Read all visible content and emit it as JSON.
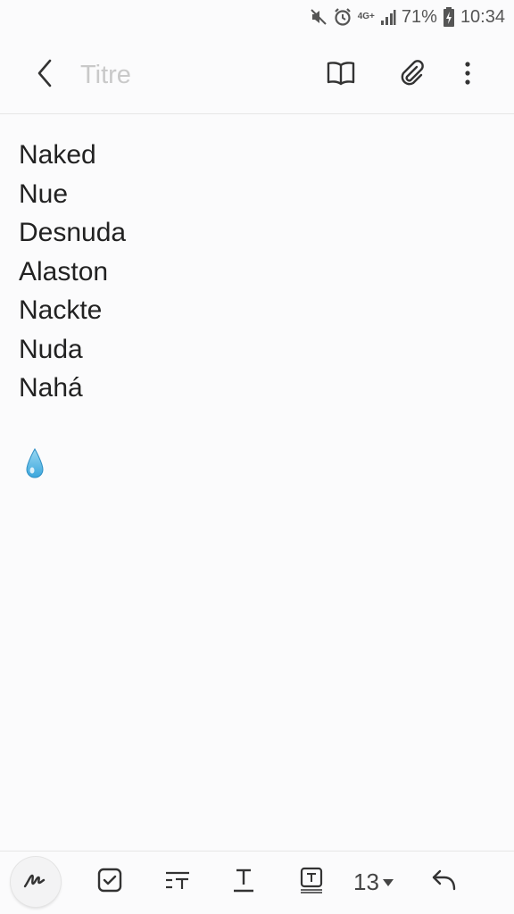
{
  "status_bar": {
    "network": "4G+",
    "battery_percent": "71%",
    "time": "10:34"
  },
  "header": {
    "title_placeholder": "Titre",
    "title_value": "",
    "icons": [
      "back-icon",
      "book-icon",
      "attachment-icon",
      "more-icon"
    ]
  },
  "note": {
    "lines": [
      "Naked",
      "Nue",
      "Desnuda",
      "Alaston",
      "Nackte",
      "Nuda",
      "Nahá"
    ],
    "emoji": "droplet-icon"
  },
  "toolbar": {
    "font_size": "13",
    "icons": [
      "pen-icon",
      "checkbox-icon",
      "text-style-icon",
      "underline-icon",
      "text-box-icon",
      "undo-icon"
    ]
  },
  "colors": {
    "background": "#fbfbfc",
    "icon": "#333333",
    "placeholder": "#c9c9c9",
    "droplet": "#6fc3e8"
  }
}
